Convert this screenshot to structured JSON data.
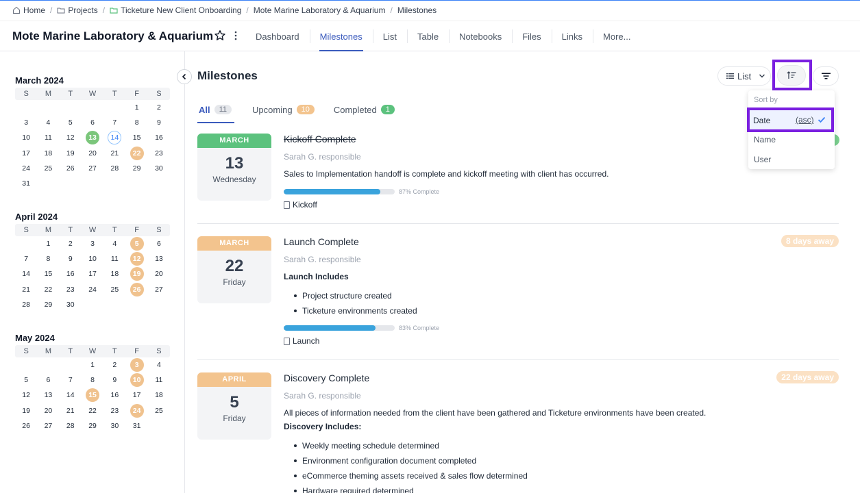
{
  "breadcrumb": [
    {
      "label": "Home",
      "icon": "home-icon"
    },
    {
      "label": "Projects",
      "icon": "folder-icon"
    },
    {
      "label": "Ticketure New Client Onboarding",
      "icon": "folder-green-icon"
    },
    {
      "label": "Mote Marine Laboratory & Aquarium"
    },
    {
      "label": "Milestones"
    }
  ],
  "header": {
    "title": "Mote Marine Laboratory & Aquarium",
    "tabs": [
      "Dashboard",
      "Milestones",
      "List",
      "Table",
      "Notebooks",
      "Files",
      "Links",
      "More..."
    ],
    "active_tab": "Milestones"
  },
  "calendars": {
    "weekdays": [
      "S",
      "M",
      "T",
      "W",
      "T",
      "F",
      "S"
    ],
    "months": [
      {
        "title": "March 2024",
        "offset": 5,
        "days": 31,
        "milestones": [
          22
        ],
        "completed": [
          13
        ],
        "today": 14
      },
      {
        "title": "April 2024",
        "offset": 1,
        "days": 30,
        "milestones": [
          5,
          12,
          19,
          26
        ],
        "completed": [],
        "today": null
      },
      {
        "title": "May 2024",
        "offset": 3,
        "days": 31,
        "milestones": [
          3,
          10,
          15,
          24
        ],
        "completed": [],
        "today": null
      }
    ]
  },
  "main": {
    "title": "Milestones",
    "view_label": "List",
    "filter_tabs": [
      {
        "label": "All",
        "count": "11",
        "color": "gray"
      },
      {
        "label": "Upcoming",
        "count": "10",
        "color": "orange"
      },
      {
        "label": "Completed",
        "count": "1",
        "color": "green"
      }
    ]
  },
  "milestones": [
    {
      "month": "MARCH",
      "day": "13",
      "weekday": "Wednesday",
      "title": "Kickoff Complete",
      "responsible": "Sarah G. responsible",
      "description": "Sales to Implementation handoff is complete and kickoff meeting with client has occurred.",
      "progress": 87,
      "progress_label": "87% Complete",
      "tag": "Kickoff"
    },
    {
      "month": "MARCH",
      "day": "22",
      "weekday": "Friday",
      "title": "Launch Complete",
      "responsible": "Sarah G. responsible",
      "away": "8 days away",
      "includes_title": "Launch Includes",
      "includes": [
        "Project structure created",
        "Ticketure environments created"
      ],
      "progress": 83,
      "progress_label": "83% Complete",
      "tag": "Launch"
    },
    {
      "month": "APRIL",
      "day": "5",
      "weekday": "Friday",
      "title": "Discovery Complete",
      "responsible": "Sarah G. responsible",
      "away": "22 days away",
      "description": "All pieces of information needed from the client have been gathered and Ticketure environments have been created.",
      "includes_title": "Discovery Includes:",
      "includes": [
        "Weekly meeting schedule determined",
        "Environment configuration document completed",
        "eCommerce theming assets received & sales flow determined",
        "Hardware required determined"
      ]
    }
  ],
  "sort_menu": {
    "header": "Sort by",
    "items": [
      "Date",
      "Name",
      "User"
    ],
    "selected": "Date",
    "direction": "(asc)"
  },
  "colors": {
    "accent": "#3b5bbd",
    "milestone": "#f0c28e",
    "completed": "#5cc27e",
    "highlight": "#7a1fe0",
    "progress": "#3aa3dc"
  }
}
